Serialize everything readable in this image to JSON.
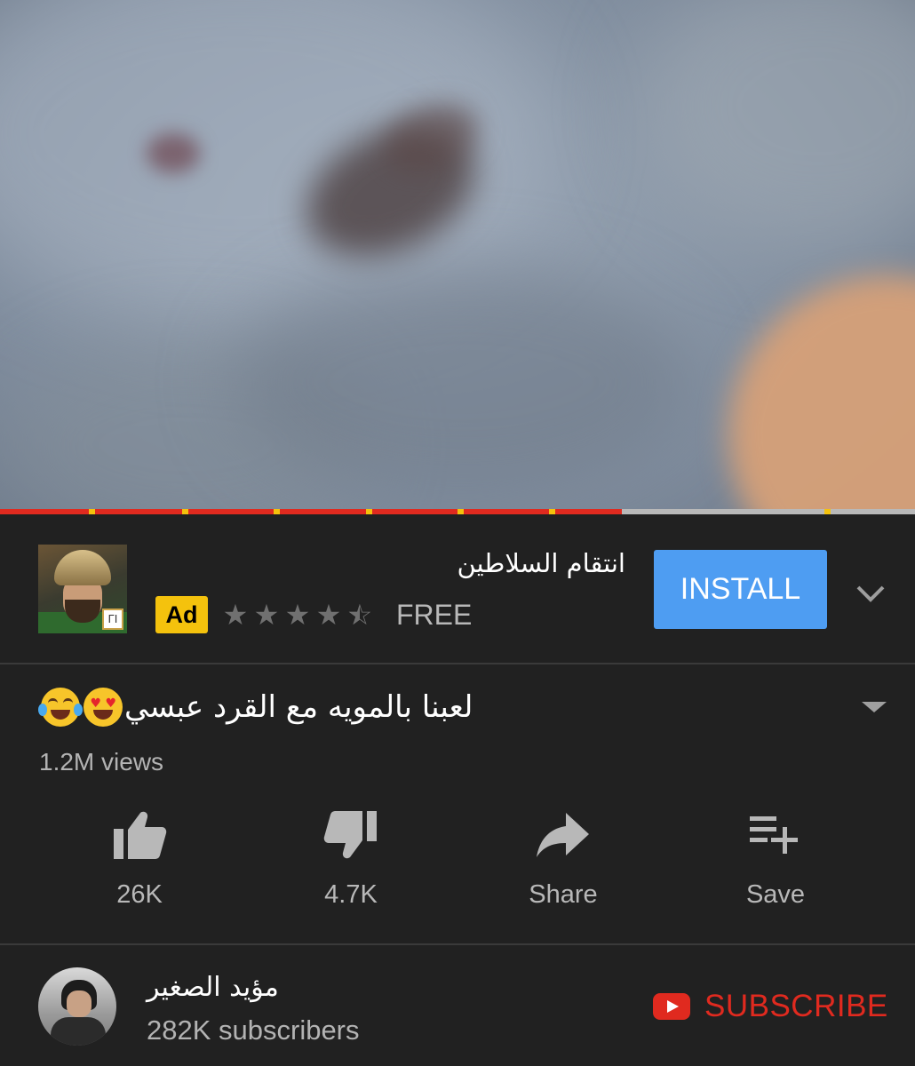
{
  "video": {
    "progress_fraction": 0.68
  },
  "ad": {
    "title": "انتقام السلاطين",
    "tag": "Ad",
    "rating": 4.5,
    "price": "FREE",
    "install_label": "INSTALL"
  },
  "video_info": {
    "title": "لعبنا بالمويه مع القرد عبسي",
    "views": "1.2M views"
  },
  "actions": {
    "like": {
      "label": "26K",
      "icon": "thumbs-up-icon"
    },
    "dislike": {
      "label": "4.7K",
      "icon": "thumbs-down-icon"
    },
    "share": {
      "label": "Share",
      "icon": "share-arrow-icon"
    },
    "save": {
      "label": "Save",
      "icon": "playlist-add-icon"
    }
  },
  "channel": {
    "name": "مؤيد الصغير",
    "subscribers": "282K subscribers",
    "subscribe_label": "SUBSCRIBE"
  },
  "colors": {
    "background": "#212121",
    "install_blue": "#4e9df2",
    "ad_yellow": "#f4c20d",
    "youtube_red": "#e02a1f"
  }
}
